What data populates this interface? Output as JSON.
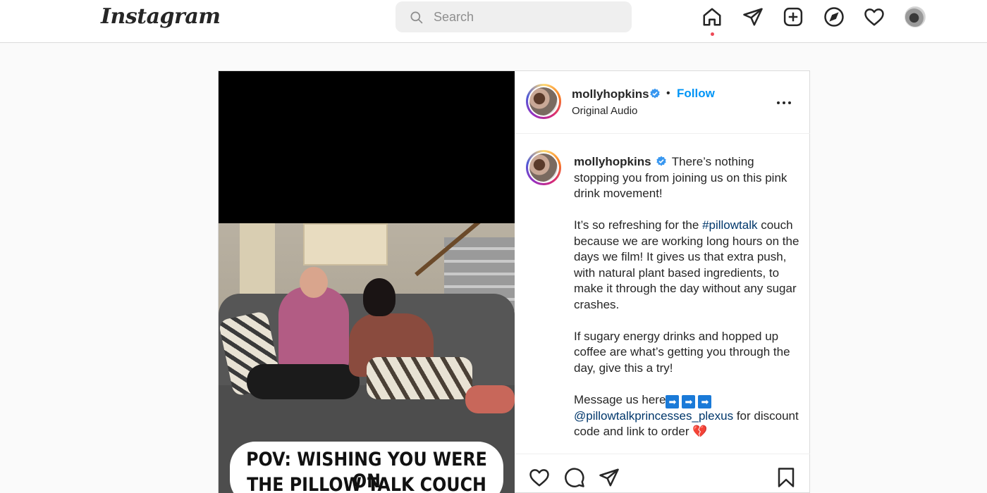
{
  "brand": {
    "logo_text": "Instagram"
  },
  "search": {
    "placeholder": "Search"
  },
  "nav": {
    "icons": [
      "home-icon",
      "direct-message-icon",
      "new-post-icon",
      "explore-icon",
      "activity-heart-icon",
      "profile-avatar"
    ],
    "home_active": true
  },
  "post": {
    "header": {
      "username": "mollyhopkins",
      "verified": true,
      "separator": "•",
      "follow_label": "Follow",
      "audio_label": "Original Audio"
    },
    "media": {
      "caption_line_1": "POV: WISHING YOU WERE ON",
      "caption_line_2": "THE PILLOW TALK COUCH"
    },
    "caption": {
      "username": "mollyhopkins",
      "p1": "There’s nothing stopping you from joining us on this pink drink movement!",
      "p2_before": "It’s so refreshing for the ",
      "p2_hashtag": "#pillowtalk",
      "p2_after": " couch because we are working long hours on the days we film! It gives us that extra push, with natural plant based ingredients, to make it through the day without any sugar crashes.",
      "p3": "If sugary energy drinks and hopped up coffee are what’s getting you through the day, give this a try!",
      "p4_before": "Message us here",
      "arrow_glyph": "➡",
      "mention": "@pillowtalkprincesses_plexus",
      "p4_after": " for discount code and link to order ",
      "heart_emoji": "💔"
    },
    "actions": [
      "like-icon",
      "comment-icon",
      "share-icon",
      "save-icon"
    ]
  },
  "colors": {
    "follow_blue": "#0095f6",
    "link_blue": "#00376b",
    "notification_red": "#ed4956",
    "border": "#dbdbdb"
  }
}
